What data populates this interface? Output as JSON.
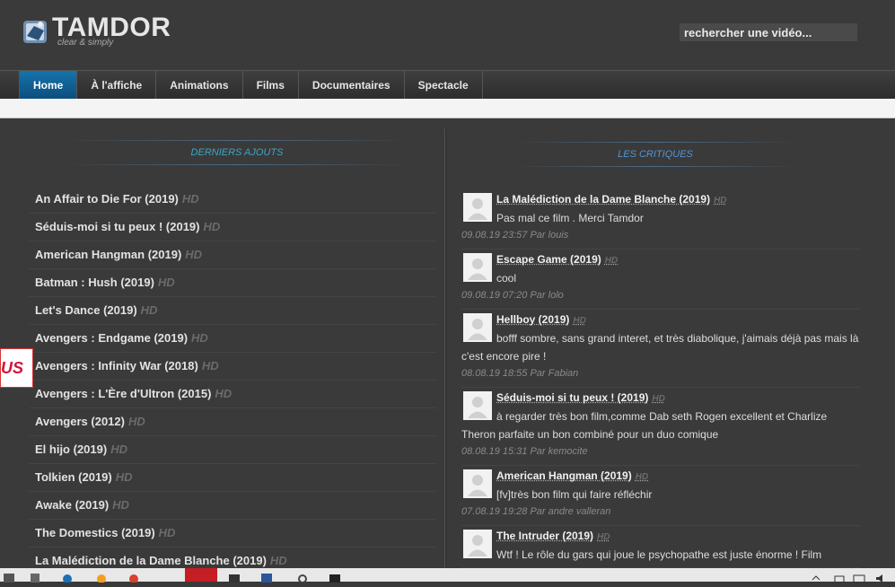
{
  "logo": {
    "title": "TAMDOR",
    "subtitle": "clear & simply"
  },
  "search": {
    "placeholder": "rechercher une vidéo..."
  },
  "nav": {
    "items": [
      "Home",
      "À l'affiche",
      "Animations",
      "Films",
      "Documentaires",
      "Spectacle"
    ],
    "active": "Home"
  },
  "left": {
    "heading": "DERNIERS AJOUTS",
    "hd_label": "HD",
    "movies": [
      "An Affair to Die For (2019)",
      "Séduis-moi si tu peux ! (2019)",
      "American Hangman (2019)",
      "Batman : Hush (2019)",
      "Let's Dance (2019)",
      "Avengers : Endgame (2019)",
      "Avengers : Infinity War (2018)",
      "Avengers : L'Ère d'Ultron (2015)",
      "Avengers (2012)",
      "El hijo (2019)",
      "Tolkien (2019)",
      "Awake (2019)",
      "The Domestics (2019)",
      "La Malédiction de la Dame Blanche (2019)"
    ]
  },
  "side_badge": {
    "text": "US"
  },
  "right": {
    "heading": "LES CRITIQUES",
    "reviews": [
      {
        "title": "La Malédiction de la Dame Blanche (2019)",
        "hd": "HD",
        "text": "Pas mal ce film . Merci Tamdor",
        "meta": "09.08.19 23:57 Par louis"
      },
      {
        "title": "Escape Game (2019)",
        "hd": "HD",
        "text": "cool",
        "meta": "09.08.19 07:20 Par lolo"
      },
      {
        "title": "Hellboy (2019)",
        "hd": "HD",
        "text": "bofff sombre, sans grand interet, et très diabolique, j'aimais déjà pas mais là c'est encore pire !",
        "meta": "08.08.19 18:55 Par Fabian"
      },
      {
        "title": "Séduis-moi si tu peux ! (2019)",
        "hd": "HD",
        "text": "à regarder très bon film,comme Dab seth Rogen excellent et Charlize Theron parfaite un bon combiné pour un duo comique",
        "meta": "08.08.19 15:31 Par kemocite"
      },
      {
        "title": "American Hangman (2019)",
        "hd": "HD",
        "text": "[fv]très bon film qui faire réfléchir",
        "meta": "07.08.19 19:28 Par andre valleran"
      },
      {
        "title": "The Intruder (2019)",
        "hd": "HD",
        "text": "Wtf ! Le rôle du gars qui joue le psychopathe est juste énorme ! Film",
        "meta": ""
      }
    ]
  },
  "colors": {
    "accent_nav": "#1673ad",
    "heading_left": "#3ca6c6",
    "heading_right": "#4f96d8"
  }
}
